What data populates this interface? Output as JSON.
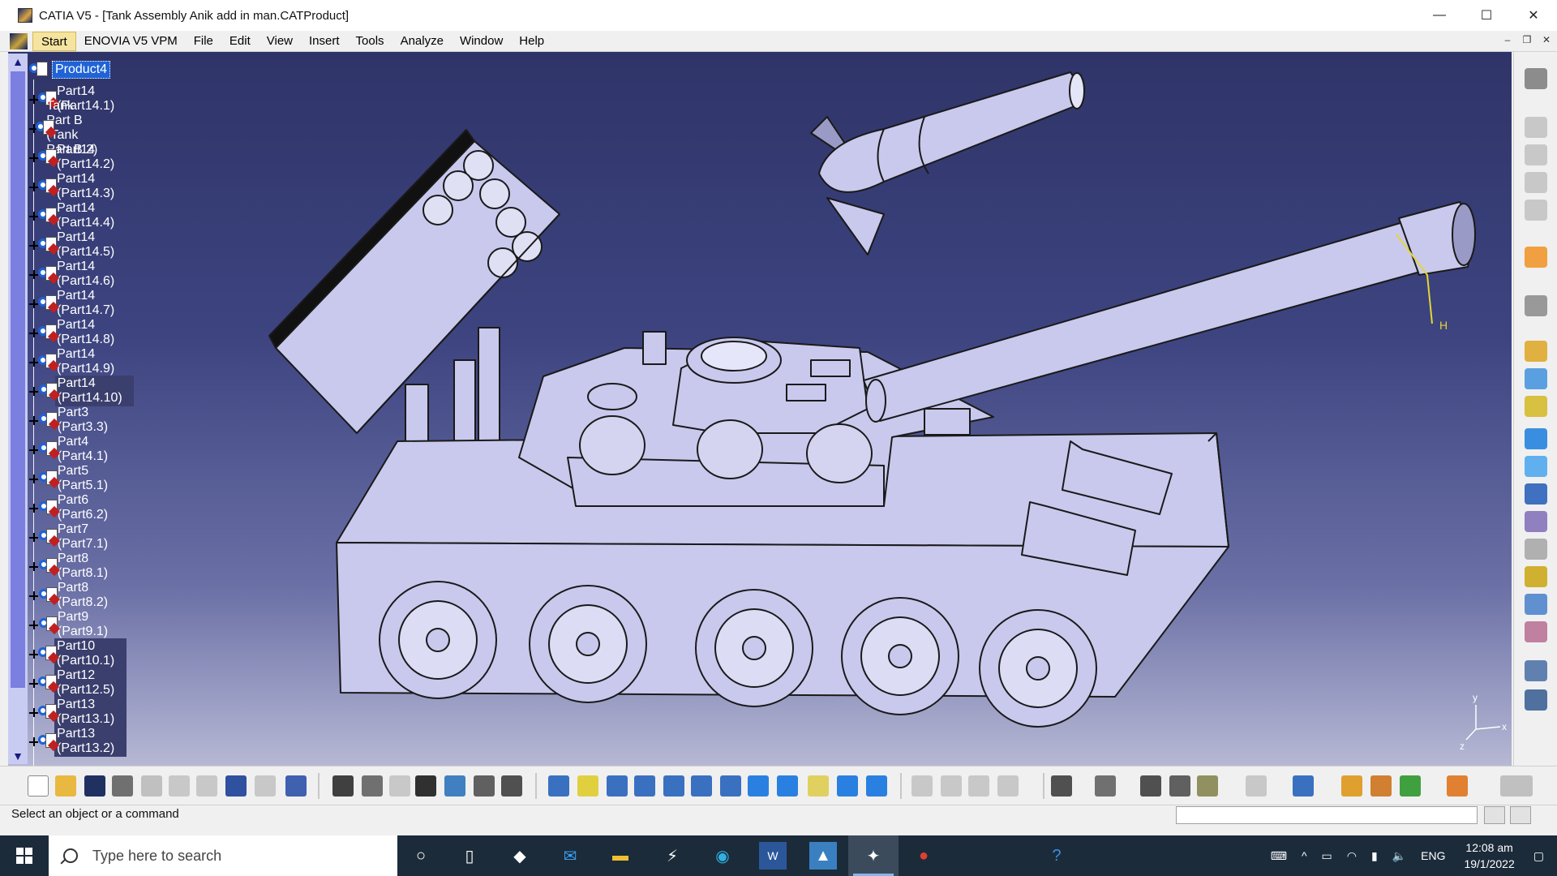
{
  "window": {
    "title": "CATIA V5 - [Tank Assembly Anik add in man.CATProduct]",
    "controls": [
      "—",
      "☐",
      "✕"
    ]
  },
  "menu": {
    "items": [
      {
        "label": "Start",
        "active": true
      },
      {
        "label": "ENOVIA V5 VPM",
        "active": false
      },
      {
        "label": "File",
        "active": false
      },
      {
        "label": "Edit",
        "active": false
      },
      {
        "label": "View",
        "active": false
      },
      {
        "label": "Insert",
        "active": false
      },
      {
        "label": "Tools",
        "active": false
      },
      {
        "label": "Analyze",
        "active": false
      },
      {
        "label": "Window",
        "active": false
      },
      {
        "label": "Help",
        "active": false
      }
    ]
  },
  "tree": {
    "root": "Product4",
    "items": [
      {
        "label": "Part14 (Part14.1)"
      },
      {
        "label": "Tank Part B (Tank Part B.2)"
      },
      {
        "label": "Part14 (Part14.2)"
      },
      {
        "label": "Part14 (Part14.3)"
      },
      {
        "label": "Part14 (Part14.4)"
      },
      {
        "label": "Part14 (Part14.5)"
      },
      {
        "label": "Part14 (Part14.6)"
      },
      {
        "label": "Part14 (Part14.7)"
      },
      {
        "label": "Part14 (Part14.8)"
      },
      {
        "label": "Part14 (Part14.9)"
      },
      {
        "label": "Part14 (Part14.10)"
      },
      {
        "label": "Part3 (Part3.3)"
      },
      {
        "label": "Part4 (Part4.1)"
      },
      {
        "label": "Part5 (Part5.1)"
      },
      {
        "label": "Part6 (Part6.2)"
      },
      {
        "label": "Part7 (Part7.1)"
      },
      {
        "label": "Part8 (Part8.1)"
      },
      {
        "label": "Part8 (Part8.2)"
      },
      {
        "label": "Part9 (Part9.1)"
      },
      {
        "label": "Part10 (Part10.1)"
      },
      {
        "label": "Part12 (Part12.5)"
      },
      {
        "label": "Part13 (Part13.1)"
      },
      {
        "label": "Part13 (Part13.2)"
      }
    ]
  },
  "viewport": {
    "axis_label_h": "H",
    "compass_x": "x",
    "compass_y": "y",
    "compass_z": "z",
    "bg_top": "#2f3468",
    "bg_bottom": "#b6b8d4"
  },
  "status": {
    "message": "Select an object or a command"
  },
  "taskbar": {
    "search_placeholder": "Type here to search",
    "language": "ENG",
    "time": "12:08 am",
    "date": "19/1/2022"
  },
  "colors": {
    "accent": "#1f63d6",
    "model": "#c9c9ee"
  }
}
